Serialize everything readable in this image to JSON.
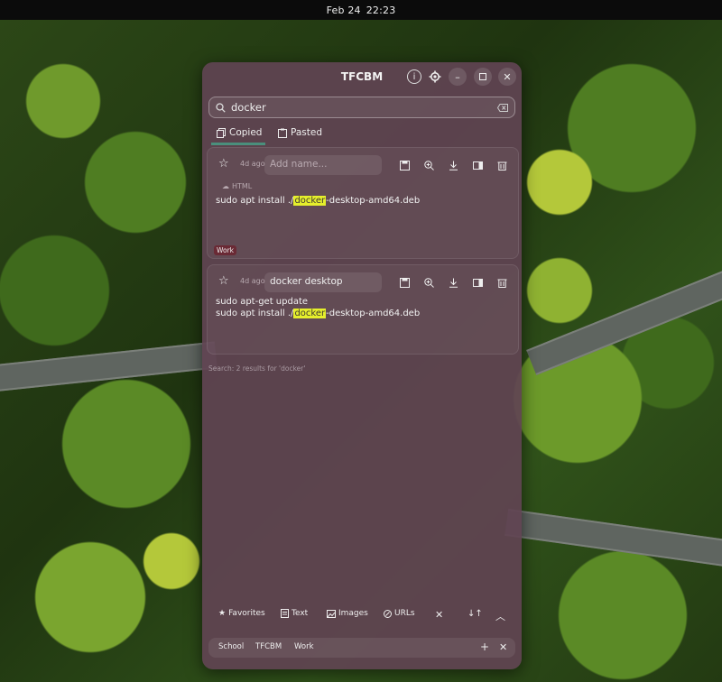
{
  "topbar": {
    "date": "Feb 24",
    "time": "22:23"
  },
  "window": {
    "title": "TFCBM"
  },
  "search": {
    "value": "docker"
  },
  "tabs": [
    {
      "label": "Copied",
      "active": true
    },
    {
      "label": "Pasted",
      "active": false
    }
  ],
  "items": [
    {
      "time": "4d ago",
      "name_placeholder": "Add name...",
      "type_label": "HTML",
      "line1_prefix": "sudo apt install ./",
      "line1_highlight": "docker",
      "line1_suffix": "-desktop-amd64.deb",
      "tag": "Work"
    },
    {
      "time": "4d ago",
      "name": "docker desktop",
      "line1": "sudo apt-get update",
      "line2_prefix": "sudo apt install ./",
      "line2_highlight": "docker",
      "line2_suffix": "-desktop-amd64.deb"
    }
  ],
  "status": "Search: 2 results for 'docker'",
  "filters": {
    "favorites": "Favorites",
    "text": "Text",
    "images": "Images",
    "urls": "URLs"
  },
  "tags": [
    "School",
    "TFCBM",
    "Work"
  ],
  "colors": {
    "highlight": "#e5ef2c",
    "window_bg": "#604452",
    "tag_work": "#6a2a35"
  }
}
